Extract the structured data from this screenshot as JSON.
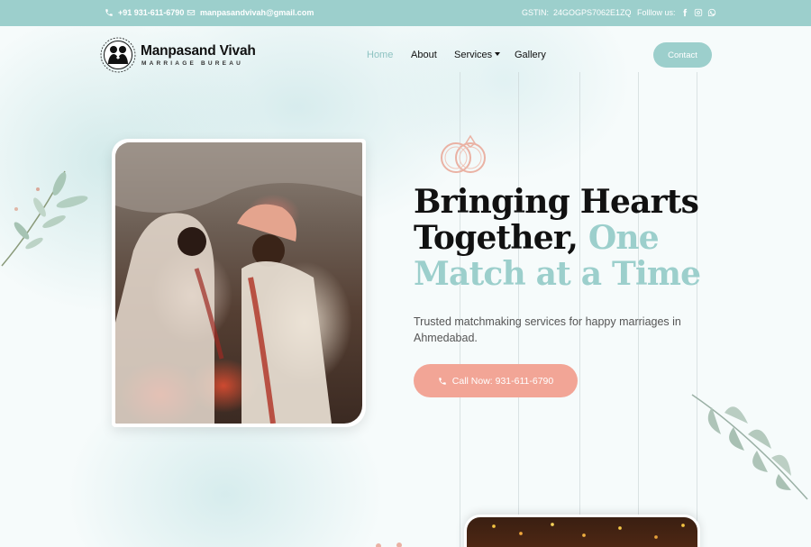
{
  "topbar": {
    "phone": "+91 931-611-6790",
    "email": "manpasandvivah@gmail.com",
    "gstin_label": "GSTIN:",
    "gstin_value": "24GOGPS7062E1ZQ",
    "follow_label": "Folllow us:",
    "social_icons": [
      "facebook-icon",
      "instagram-icon",
      "whatsapp-icon"
    ]
  },
  "brand": {
    "name": "Manpasand Vivah",
    "subtitle": "MARRIAGE BUREAU"
  },
  "nav": {
    "items": [
      "Home",
      "About",
      "Services",
      "Gallery"
    ],
    "active": "Home",
    "contact_label": "Contact"
  },
  "hero": {
    "heading_line1": "Bringing Hearts",
    "heading_line2_dark": "Together,",
    "heading_line2_accent": "One",
    "heading_line3_accent": "Match at a Time",
    "tagline": "Trusted matchmaking services for happy marriages in Ahmedabad.",
    "call_label": "Call Now: 931-611-6790"
  },
  "colors": {
    "accent_teal": "#9ccfcc",
    "accent_peach": "#f2a596",
    "text_dark": "#111111"
  }
}
